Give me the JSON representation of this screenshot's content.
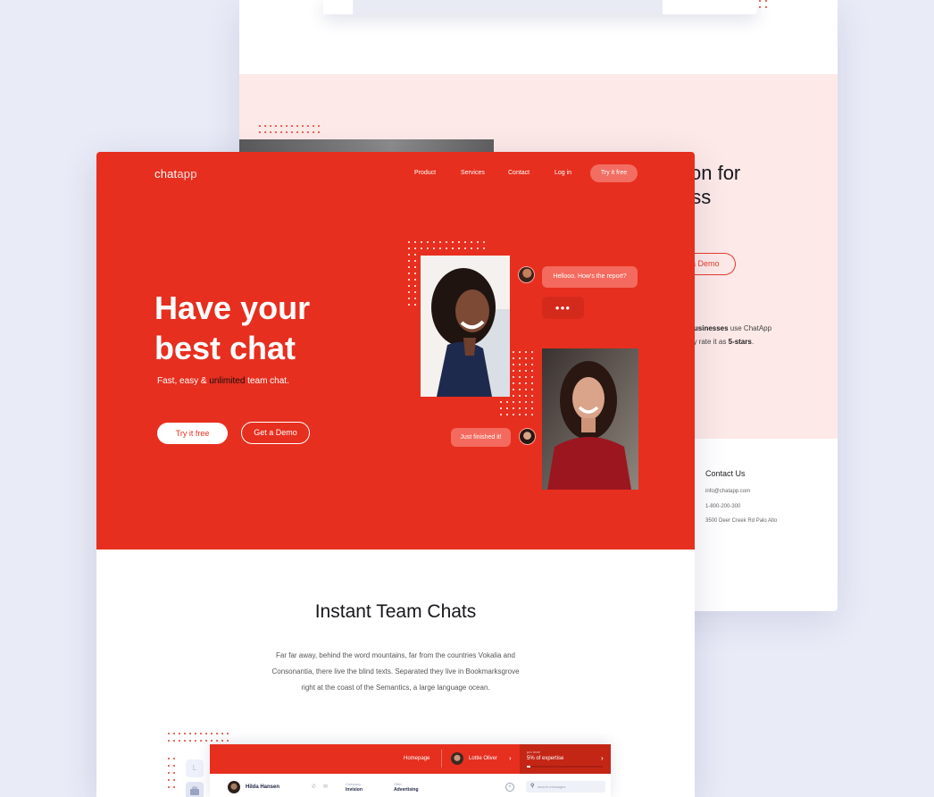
{
  "back_page": {
    "heading": "tion for\ness",
    "demo_label": "a Demo",
    "stat_line1_bold": "businesses",
    "stat_line1_rest": " use ChatApp",
    "stat_line2_pre": "ey rate it as ",
    "stat_line2_bold": "5-stars",
    "stat_line2_post": ".",
    "contact_title": "Contact Us",
    "contact_email": "info@chatapp.com",
    "contact_phone": "1-800-200-300",
    "contact_address": "3500 Deer Creek Rd Palo Alto"
  },
  "header": {
    "logo_bold": "chat",
    "logo_light": "app",
    "nav": [
      "Product",
      "Services",
      "Contact",
      "Log in"
    ],
    "cta": "Try it free"
  },
  "hero": {
    "title_line1": "Have your",
    "title_line2": "best chat",
    "subtitle_pre": "Fast, easy & ",
    "subtitle_highlight": "unlimited",
    "subtitle_post": " team chat.",
    "primary_button": "Try it free",
    "secondary_button": "Get a Demo",
    "chat_message_1": "Hellooo. How's the report?",
    "chat_typing": "●●●",
    "chat_message_2": "Just finished it!"
  },
  "features": {
    "title": "Instant Team Chats",
    "body": "Far far away, behind the word mountains, far from the countries Vokalia and Consonantia, there live the blind texts. Separated they live in Bookmarksgrove right at the coast of the Semantics, a large language ocean."
  },
  "app_preview": {
    "side_letter": "L",
    "nav_homepage": "Homepage",
    "user_name": "Lottie Oliver",
    "skill_label": "pro level",
    "skill_value": "5% of expertise",
    "contact_name": "Hilda Hansen",
    "company_label": "Company",
    "company_value": "Invision",
    "offer_label": "Offer",
    "offer_value": "Advertising",
    "search_placeholder": "search messages"
  },
  "colors": {
    "brand_red": "#e72f1f",
    "background": "#e9ebf7",
    "pink_section": "#fde9e7"
  }
}
